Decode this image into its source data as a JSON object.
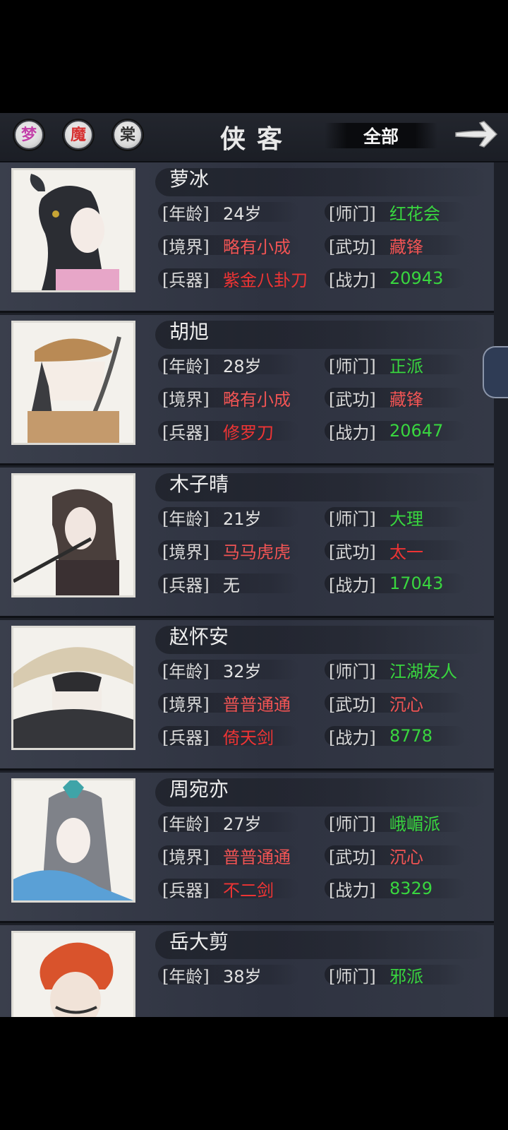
{
  "header": {
    "filters": [
      {
        "glyph": "梦",
        "color": "#c23fa8"
      },
      {
        "glyph": "魔",
        "color": "#d63333"
      },
      {
        "glyph": "棠",
        "color": "#333333"
      }
    ],
    "title": "侠客",
    "all_filter": "全部",
    "next_icon": "arrow-right-icon"
  },
  "labels": {
    "age": "[年龄]",
    "realm": "[境界]",
    "weapon": "[兵器]",
    "sect": "[师门]",
    "skill": "[武功]",
    "power": "[战力]"
  },
  "heroes": [
    {
      "name": "萝冰",
      "age": "24岁",
      "sect": "红花会",
      "realm": "略有小成",
      "skill": "藏锋",
      "weapon": "紫金八卦刀",
      "power": "20943"
    },
    {
      "name": "胡旭",
      "age": "28岁",
      "sect": "正派",
      "realm": "略有小成",
      "skill": "藏锋",
      "weapon": "修罗刀",
      "power": "20647"
    },
    {
      "name": "木子晴",
      "age": "21岁",
      "sect": "大理",
      "realm": "马马虎虎",
      "skill": "太一",
      "weapon": "无",
      "power": "17043"
    },
    {
      "name": "赵怀安",
      "age": "32岁",
      "sect": "江湖友人",
      "realm": "普普通通",
      "skill": "沉心",
      "weapon": "倚天剑",
      "power": "8778"
    },
    {
      "name": "周宛亦",
      "age": "27岁",
      "sect": "峨嵋派",
      "realm": "普普通通",
      "skill": "沉心",
      "weapon": "不二剑",
      "power": "8329"
    },
    {
      "name": "岳大剪",
      "age": "38岁",
      "sect": "邪派"
    }
  ]
}
